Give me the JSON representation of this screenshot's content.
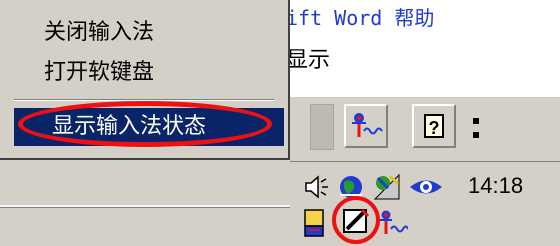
{
  "background_window": {
    "title_fragment": "ift Word 帮助",
    "line2_fragment": "显示"
  },
  "ime_menu": {
    "items": [
      {
        "label": "关闭输入法"
      },
      {
        "label": "打开软键盘"
      },
      {
        "label": "显示输入法状态",
        "selected": true
      }
    ]
  },
  "toolbar": {
    "icons": [
      "ime-status-icon",
      "help-icon",
      "toolbar-grip-icon"
    ],
    "help_glyph": "?"
  },
  "tray": {
    "time": "14:18",
    "icons": [
      "speaker-icon",
      "globe-network-icon",
      "satellite-icon",
      "eye-icon",
      "ime-indicator-icon",
      "soft-keyboard-pen-icon",
      "ime-pinyin-icon"
    ]
  },
  "colors": {
    "menu_bg": "#d4d0c8",
    "selection": "#0a246a",
    "annotation_red": "#ee1111"
  }
}
